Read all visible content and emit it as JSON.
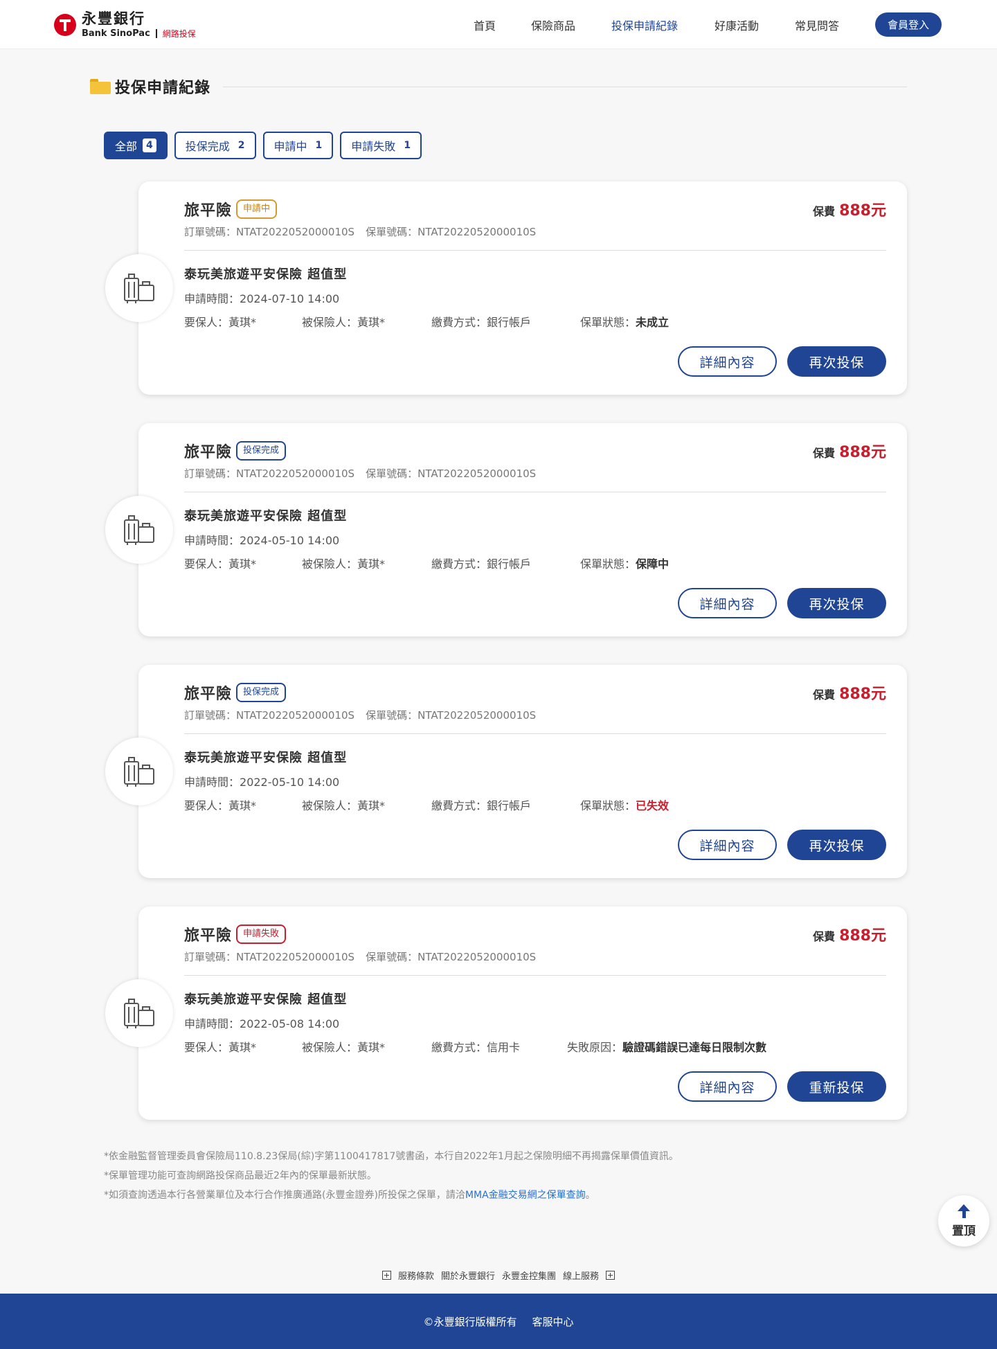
{
  "brand": {
    "name_zh": "永豐銀行",
    "name_en": "Bank SinoPac",
    "channel": "網路投保",
    "color": "#1f4594",
    "accent_red": "#c81e2d"
  },
  "nav": {
    "items": [
      {
        "label": "首頁",
        "active": false
      },
      {
        "label": "保險商品",
        "active": false
      },
      {
        "label": "投保申請紀錄",
        "active": true
      },
      {
        "label": "好康活動",
        "active": false
      },
      {
        "label": "常見問答",
        "active": false
      }
    ],
    "login": "會員登入"
  },
  "page": {
    "title": "投保申請紀錄",
    "title_icon": "folder-icon"
  },
  "tabs": [
    {
      "label": "全部",
      "count": "4",
      "active": true
    },
    {
      "label": "投保完成",
      "count": "2",
      "active": false
    },
    {
      "label": "申請中",
      "count": "1",
      "active": false
    },
    {
      "label": "申請失敗",
      "count": "1",
      "active": false
    }
  ],
  "labels": {
    "premium": "保費",
    "order_no": "訂單號碼：",
    "policy_no": "保單號碼：",
    "apply_time": "申請時間：",
    "applicant": "要保人：",
    "insured": "被保險人：",
    "payment": "繳費方式：",
    "policy_status": "保單狀態：",
    "fail_reason": "失敗原因：",
    "detail_btn": "詳細內容",
    "reapply_btn": "再次投保",
    "retry_btn": "重新投保"
  },
  "records": [
    {
      "type": "旅平險",
      "badge": "申請中",
      "badge_kind": "pending",
      "premium": "888元",
      "order_no": "NTAT2022052000010S",
      "policy_no": "NTAT2022052000010S",
      "product": "泰玩美旅遊平安保險 超值型",
      "apply_time": "2024-07-10 14:00",
      "applicant": "黃琪*",
      "insured": "黃琪*",
      "payment": "銀行帳戶",
      "status_label": "保單狀態：",
      "status": "未成立",
      "status_kind": "normal",
      "action": "再次投保"
    },
    {
      "type": "旅平險",
      "badge": "投保完成",
      "badge_kind": "done",
      "premium": "888元",
      "order_no": "NTAT2022052000010S",
      "policy_no": "NTAT2022052000010S",
      "product": "泰玩美旅遊平安保險 超值型",
      "apply_time": "2024-05-10 14:00",
      "applicant": "黃琪*",
      "insured": "黃琪*",
      "payment": "銀行帳戶",
      "status_label": "保單狀態：",
      "status": "保障中",
      "status_kind": "normal",
      "action": "再次投保"
    },
    {
      "type": "旅平險",
      "badge": "投保完成",
      "badge_kind": "done",
      "premium": "888元",
      "order_no": "NTAT2022052000010S",
      "policy_no": "NTAT2022052000010S",
      "product": "泰玩美旅遊平安保險 超值型",
      "apply_time": "2022-05-10 14:00",
      "applicant": "黃琪*",
      "insured": "黃琪*",
      "payment": "銀行帳戶",
      "status_label": "保單狀態：",
      "status": "已失效",
      "status_kind": "red",
      "action": "再次投保"
    },
    {
      "type": "旅平險",
      "badge": "申請失敗",
      "badge_kind": "failed",
      "premium": "888元",
      "order_no": "NTAT2022052000010S",
      "policy_no": "NTAT2022052000010S",
      "product": "泰玩美旅遊平安保險 超值型",
      "apply_time": "2022-05-08 14:00",
      "applicant": "黃琪*",
      "insured": "黃琪*",
      "payment": "信用卡",
      "status_label": "失敗原因：",
      "status": "驗證碼錯誤已達每日限制次數",
      "status_kind": "normal",
      "action": "重新投保"
    }
  ],
  "notes": {
    "line1": "*依金融監督管理委員會保險局110.8.23保局(綜)字第1100417817號書函，本行自2022年1月起之保險明細不再揭露保單價值資訊。",
    "line2": "*保單管理功能可查詢網路投保商品最近2年內的保單最新狀態。",
    "line3_prefix": "*如須查詢透過本行各營業單位及本行合作推廣通路(永豐金證券)所投保之保單，請洽",
    "line3_link": "MMA金融交易網之保單查詢",
    "line3_suffix": "。"
  },
  "to_top": "置頂",
  "footer": {
    "links": [
      "服務條款",
      "關於永豐銀行",
      "永豐金控集團",
      "線上服務"
    ],
    "copyright": "©永豐銀行版權所有",
    "service": "客服中心"
  }
}
